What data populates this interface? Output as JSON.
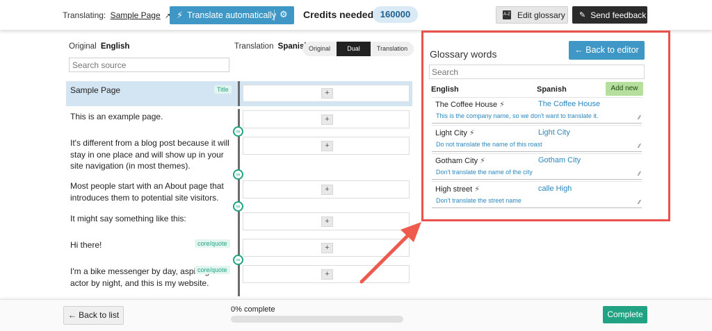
{
  "header": {
    "translating_label": "Translating:",
    "page_link": "Sample Page",
    "translate_button": "Translate automatically",
    "credits_label": "Credits needed",
    "credits_value": "160000",
    "edit_glossary": "Edit glossary",
    "send_feedback": "Send feedback"
  },
  "editor": {
    "original_label": "Original",
    "original_lang": "English",
    "translation_label": "Translation",
    "translation_lang": "Spanish",
    "view_modes": [
      "Original",
      "Dual",
      "Translation"
    ],
    "active_view": "Dual",
    "search_placeholder": "Search source",
    "rows": [
      {
        "text": "Sample Page",
        "tag": "Title"
      },
      {
        "text": "This is an example page.",
        "tag": ""
      },
      {
        "text": "It's different from a blog post because it will stay in one place and will show up in your site navigation (in most themes).",
        "tag": ""
      },
      {
        "text": "Most people start with an About page that introduces them to potential site visitors.",
        "tag": ""
      },
      {
        "text": "It might say something like this:",
        "tag": ""
      },
      {
        "text": "Hi there!",
        "tag": "core/quote"
      },
      {
        "text": "I'm a bike messenger by day, aspiring actor by night, and this is my website.",
        "tag": "core/quote"
      }
    ],
    "add_symbol": "+"
  },
  "glossary": {
    "title": "Glossary words",
    "back_button": "← Back to editor",
    "search_placeholder": "Search",
    "col_source": "English",
    "col_target": "Spanish",
    "add_button": "Add new",
    "entries": [
      {
        "source": "The Coffee House",
        "target": "The Coffee House",
        "note": "This is the company name, so we don't want to translate it."
      },
      {
        "source": "Light City",
        "target": "Light City",
        "note": "Do not translate the name of this roast"
      },
      {
        "source": "Gotham City",
        "target": "Gotham City",
        "note": "Don't translate the name of the city"
      },
      {
        "source": "High street",
        "target": "calle High",
        "note": "Don't translate the street name"
      }
    ]
  },
  "footer": {
    "back_to_list": "← Back to list",
    "progress_label": "0% complete",
    "progress_fraction": 0,
    "complete_button": "Complete"
  },
  "colors": {
    "accent": "#3e97c5",
    "success": "#21a383",
    "highlight_frame": "#e9524a",
    "annotation_arrow": "#ee5a4e"
  },
  "icons": [
    "external-link-icon",
    "bolt-icon",
    "gear-icon",
    "az-glossary-icon",
    "pen-icon",
    "link-chain-icon",
    "resize-grip-icon"
  ]
}
